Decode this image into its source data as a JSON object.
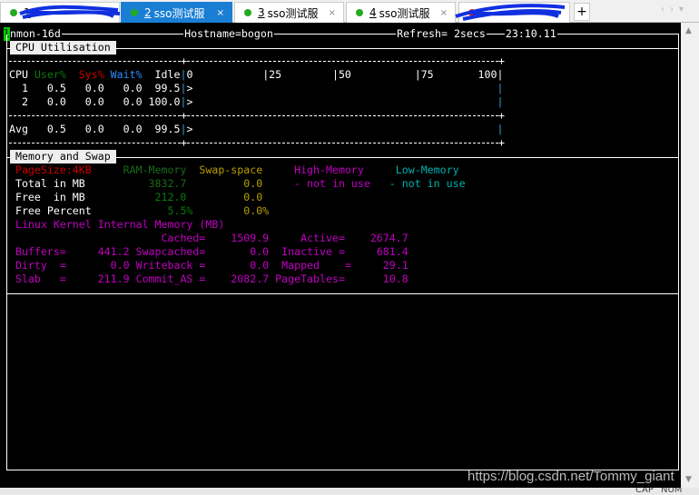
{
  "tabs": [
    {
      "num": "1",
      "label": "",
      "dot": "#22aa22",
      "active": false
    },
    {
      "num": "2",
      "label": "sso测试服",
      "dot": "#22aa22",
      "active": true
    },
    {
      "num": "3",
      "label": "sso测试服",
      "dot": "#22aa22",
      "active": false
    },
    {
      "num": "4",
      "label": "sso测试服",
      "dot": "#22aa22",
      "active": false
    },
    {
      "num": "",
      "label": "",
      "dot": "#dd2222",
      "active": false
    }
  ],
  "tab_close": "×",
  "new_tab": "+",
  "nav_arrows": "‹›▾",
  "header": {
    "cursor": "l",
    "app": "nmon-16d",
    "hostname": "Hostname=bogon",
    "refresh": "Refresh= 2secs",
    "time": "23:10.11"
  },
  "cpu": {
    "title": "CPU Utilisation",
    "headers": {
      "cpu": "CPU",
      "user": "User%",
      "sys": "Sys%",
      "wait": "Wait%",
      "idle": "Idle",
      "pipe": "|",
      "s0": "0",
      "s25": "|25",
      "s50": "|50",
      "s75": "|75",
      "s100": "100|"
    },
    "rows": [
      {
        "cpu": "1",
        "user": "0.5",
        "sys": "0.0",
        "wait": "0.0",
        "idle": "99.5",
        "bar": ">"
      },
      {
        "cpu": "2",
        "user": "0.0",
        "sys": "0.0",
        "wait": "0.0",
        "idle": "100.0",
        "bar": ">"
      }
    ],
    "avg": {
      "cpu": "Avg",
      "user": "0.5",
      "sys": "0.0",
      "wait": "0.0",
      "idle": "99.5",
      "bar": ">"
    },
    "dash_plus": "+"
  },
  "memory": {
    "title": "Memory and Swap",
    "headers": {
      "pagesize": "PageSize:4KB",
      "ram": "RAM-Memory",
      "swap": "Swap-space",
      "high": "High-Memory",
      "low": "Low-Memory"
    },
    "total": {
      "label": "Total in MB",
      "ram": "3832.7",
      "swap": "0.0",
      "high": "- not in use",
      "low": "- not in use"
    },
    "free": {
      "label": "Free  in MB",
      "ram": "212.0",
      "swap": "0.0"
    },
    "freepct": {
      "label": "Free Percent",
      "ram": "5.5%",
      "swap": "0.0%"
    },
    "kernel_title": "Linux Kernel Internal Memory (MB)",
    "kernel": {
      "cached_l": "Cached=",
      "cached": "1509.9",
      "active_l": "Active=",
      "active": "2674.7",
      "buffers_l": "Buffers=",
      "buffers": "441.2",
      "swapcached_l": "Swapcached=",
      "swapcached": "0.0",
      "inactive_l": "Inactive =",
      "inactive": "681.4",
      "dirty_l": "Dirty  =",
      "dirty": "0.0",
      "writeback_l": "Writeback =",
      "writeback": "0.0",
      "mapped_l": "Mapped    =",
      "mapped": "29.1",
      "slab_l": "Slab   =",
      "slab": "211.9",
      "commit_l": "Commit_AS =",
      "commit": "2082.7",
      "pagetables_l": "PageTables=",
      "pagetables": "10.8"
    }
  },
  "watermark": "https://blog.csdn.net/Tommy_giant",
  "statusbar": {
    "caps": "CAP",
    "num": "NUM"
  },
  "colors": {
    "tab_active": "#1a7fd4",
    "user": "#0b7a0b",
    "sys": "#c00000",
    "wait": "#2a8cff",
    "swap": "#b8a000",
    "kernel": "#c000c0",
    "low": "#00b0b0"
  }
}
